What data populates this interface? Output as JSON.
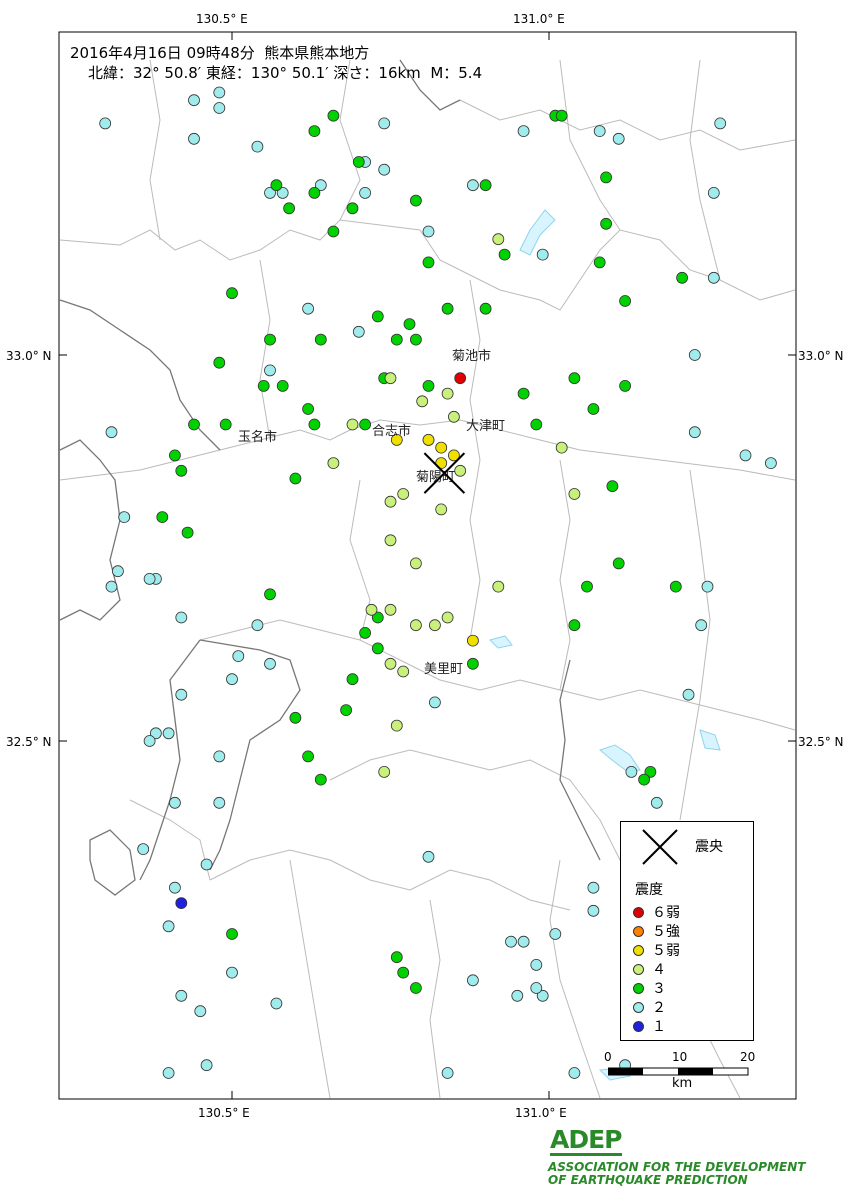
{
  "header": {
    "line1": "2016年4月16日 09時48分  熊本県熊本地方",
    "line2": "北緯：32° 50.8′ 東経：130° 50.1′ 深さ：16km  M：5.4"
  },
  "axes": {
    "top_ticks": [
      "130.5° E",
      "131.0° E"
    ],
    "bottom_ticks": [
      "130.5° E",
      "131.0° E"
    ],
    "left_ticks": [
      "33.0° N",
      "32.5° N"
    ],
    "right_ticks": [
      "33.0° N",
      "32.5° N"
    ]
  },
  "places": [
    "菊池市",
    "大津町",
    "合志市",
    "玉名市",
    "菊陽町",
    "美里町"
  ],
  "legend": {
    "epicenter_label": "震央",
    "intensity_title": "震度",
    "items": [
      {
        "label": "６弱",
        "color": "#e00000"
      },
      {
        "label": "５強",
        "color": "#ff8000"
      },
      {
        "label": "５弱",
        "color": "#f0e000"
      },
      {
        "label": "４",
        "color": "#c8f07a"
      },
      {
        "label": "３",
        "color": "#00d200"
      },
      {
        "label": "２",
        "color": "#a0ecec"
      },
      {
        "label": "１",
        "color": "#2020e0"
      }
    ]
  },
  "scale": {
    "labels": [
      "0",
      "10",
      "20"
    ],
    "unit": "km"
  },
  "logo": {
    "mark": "ADEP",
    "line1": "ASSOCIATION FOR THE DEVELOPMENT",
    "line2": "OF EARTHQUAKE PREDICTION"
  },
  "epicenter": {
    "lat": 32.847,
    "lon": 130.835
  },
  "stations": {
    "i6": [
      [
        130.86,
        32.97
      ]
    ],
    "i5": [
      [
        130.76,
        32.89
      ],
      [
        130.81,
        32.89
      ],
      [
        130.83,
        32.88
      ],
      [
        130.83,
        32.86
      ],
      [
        130.85,
        32.87
      ],
      [
        130.88,
        32.63
      ]
    ],
    "i4": [
      [
        130.75,
        32.97
      ],
      [
        130.84,
        32.95
      ],
      [
        130.69,
        32.91
      ],
      [
        130.8,
        32.94
      ],
      [
        130.85,
        32.92
      ],
      [
        130.81,
        32.89
      ],
      [
        130.66,
        32.86
      ],
      [
        130.86,
        32.85
      ],
      [
        130.77,
        32.82
      ],
      [
        130.75,
        32.81
      ],
      [
        130.83,
        32.8
      ],
      [
        130.75,
        32.76
      ],
      [
        130.79,
        32.73
      ],
      [
        130.92,
        32.7
      ],
      [
        131.04,
        32.82
      ],
      [
        131.02,
        32.88
      ],
      [
        130.72,
        32.67
      ],
      [
        130.75,
        32.67
      ],
      [
        130.79,
        32.65
      ],
      [
        130.82,
        32.65
      ],
      [
        130.84,
        32.66
      ],
      [
        130.75,
        32.6
      ],
      [
        130.77,
        32.59
      ],
      [
        130.76,
        32.52
      ],
      [
        130.74,
        32.46
      ],
      [
        130.92,
        33.15
      ]
    ],
    "i3": [
      [
        130.93,
        33.13
      ],
      [
        131.01,
        33.31
      ],
      [
        131.02,
        33.31
      ],
      [
        131.09,
        33.23
      ],
      [
        131.09,
        33.17
      ],
      [
        131.08,
        33.12
      ],
      [
        131.21,
        33.1
      ],
      [
        131.12,
        33.07
      ],
      [
        130.9,
        33.06
      ],
      [
        130.84,
        33.06
      ],
      [
        130.81,
        33.12
      ],
      [
        130.9,
        33.22
      ],
      [
        130.79,
        33.2
      ],
      [
        130.63,
        33.21
      ],
      [
        130.66,
        33.16
      ],
      [
        130.59,
        33.19
      ],
      [
        130.57,
        33.22
      ],
      [
        130.63,
        33.29
      ],
      [
        130.66,
        33.31
      ],
      [
        130.7,
        33.25
      ],
      [
        130.69,
        33.19
      ],
      [
        130.5,
        33.08
      ],
      [
        130.56,
        33.02
      ],
      [
        130.64,
        33.02
      ],
      [
        130.78,
        33.04
      ],
      [
        130.79,
        33.02
      ],
      [
        130.76,
        33.02
      ],
      [
        130.73,
        33.05
      ],
      [
        130.48,
        32.99
      ],
      [
        130.55,
        32.96
      ],
      [
        130.58,
        32.96
      ],
      [
        130.62,
        32.93
      ],
      [
        130.74,
        32.97
      ],
      [
        130.81,
        32.96
      ],
      [
        130.41,
        32.87
      ],
      [
        130.42,
        32.85
      ],
      [
        130.39,
        32.79
      ],
      [
        130.43,
        32.77
      ],
      [
        130.56,
        32.69
      ],
      [
        130.63,
        32.91
      ],
      [
        130.71,
        32.91
      ],
      [
        130.6,
        32.84
      ],
      [
        130.96,
        32.95
      ],
      [
        130.98,
        32.91
      ],
      [
        131.04,
        32.97
      ],
      [
        131.12,
        32.96
      ],
      [
        131.07,
        32.93
      ],
      [
        131.1,
        32.83
      ],
      [
        131.11,
        32.73
      ],
      [
        131.06,
        32.7
      ],
      [
        131.2,
        32.7
      ],
      [
        131.04,
        32.65
      ],
      [
        130.88,
        32.6
      ],
      [
        130.69,
        32.58
      ],
      [
        130.68,
        32.54
      ],
      [
        130.6,
        32.53
      ],
      [
        130.62,
        32.48
      ],
      [
        130.64,
        32.45
      ],
      [
        130.73,
        32.66
      ],
      [
        130.71,
        32.64
      ],
      [
        130.73,
        32.62
      ],
      [
        131.16,
        32.46
      ],
      [
        131.15,
        32.45
      ],
      [
        130.77,
        32.2
      ],
      [
        130.79,
        32.18
      ],
      [
        130.76,
        32.22
      ],
      [
        130.5,
        32.25
      ],
      [
        130.44,
        32.91
      ],
      [
        130.49,
        32.91
      ]
    ],
    "i2": [
      [
        130.3,
        33.3
      ],
      [
        130.48,
        33.32
      ],
      [
        130.44,
        33.28
      ],
      [
        130.44,
        33.33
      ],
      [
        130.48,
        33.34
      ],
      [
        130.54,
        33.27
      ],
      [
        130.56,
        33.21
      ],
      [
        130.58,
        33.21
      ],
      [
        130.64,
        33.22
      ],
      [
        130.71,
        33.25
      ],
      [
        130.71,
        33.21
      ],
      [
        130.74,
        33.3
      ],
      [
        130.74,
        33.24
      ],
      [
        130.88,
        33.22
      ],
      [
        130.99,
        33.13
      ],
      [
        130.96,
        33.29
      ],
      [
        131.08,
        33.29
      ],
      [
        131.11,
        33.28
      ],
      [
        131.27,
        33.3
      ],
      [
        131.26,
        33.21
      ],
      [
        131.26,
        33.1
      ],
      [
        131.23,
        33.0
      ],
      [
        131.23,
        32.9
      ],
      [
        131.31,
        32.87
      ],
      [
        131.35,
        32.86
      ],
      [
        131.25,
        32.7
      ],
      [
        131.24,
        32.65
      ],
      [
        131.22,
        32.56
      ],
      [
        131.17,
        32.42
      ],
      [
        131.13,
        32.46
      ],
      [
        131.07,
        32.31
      ],
      [
        131.25,
        32.32
      ],
      [
        131.25,
        32.28
      ],
      [
        131.07,
        32.28
      ],
      [
        131.01,
        32.25
      ],
      [
        130.94,
        32.24
      ],
      [
        130.96,
        32.24
      ],
      [
        130.98,
        32.21
      ],
      [
        130.99,
        32.17
      ],
      [
        130.98,
        32.18
      ],
      [
        130.95,
        32.17
      ],
      [
        130.88,
        32.19
      ],
      [
        131.12,
        32.08
      ],
      [
        131.04,
        32.07
      ],
      [
        130.84,
        32.07
      ],
      [
        130.68,
        32.02
      ],
      [
        130.57,
        32.16
      ],
      [
        130.45,
        32.15
      ],
      [
        130.4,
        32.07
      ],
      [
        130.42,
        32.17
      ],
      [
        130.5,
        32.2
      ],
      [
        130.4,
        32.26
      ],
      [
        130.41,
        32.31
      ],
      [
        130.46,
        32.34
      ],
      [
        130.36,
        32.36
      ],
      [
        130.31,
        32.7
      ],
      [
        130.31,
        32.9
      ],
      [
        130.33,
        32.79
      ],
      [
        130.42,
        32.66
      ],
      [
        130.38,
        32.71
      ],
      [
        130.37,
        32.71
      ],
      [
        130.32,
        32.72
      ],
      [
        130.48,
        32.48
      ],
      [
        130.4,
        32.51
      ],
      [
        130.38,
        32.51
      ],
      [
        130.42,
        32.56
      ],
      [
        130.54,
        32.65
      ],
      [
        130.51,
        32.61
      ],
      [
        130.56,
        32.6
      ],
      [
        130.5,
        32.58
      ],
      [
        130.48,
        32.42
      ],
      [
        130.41,
        32.42
      ],
      [
        130.37,
        32.5
      ],
      [
        130.81,
        32.35
      ],
      [
        130.82,
        32.55
      ],
      [
        130.56,
        32.98
      ],
      [
        130.62,
        33.06
      ],
      [
        130.7,
        33.03
      ],
      [
        130.81,
        33.16
      ],
      [
        130.46,
        32.08
      ]
    ],
    "i1": [
      [
        130.42,
        32.29
      ]
    ]
  }
}
